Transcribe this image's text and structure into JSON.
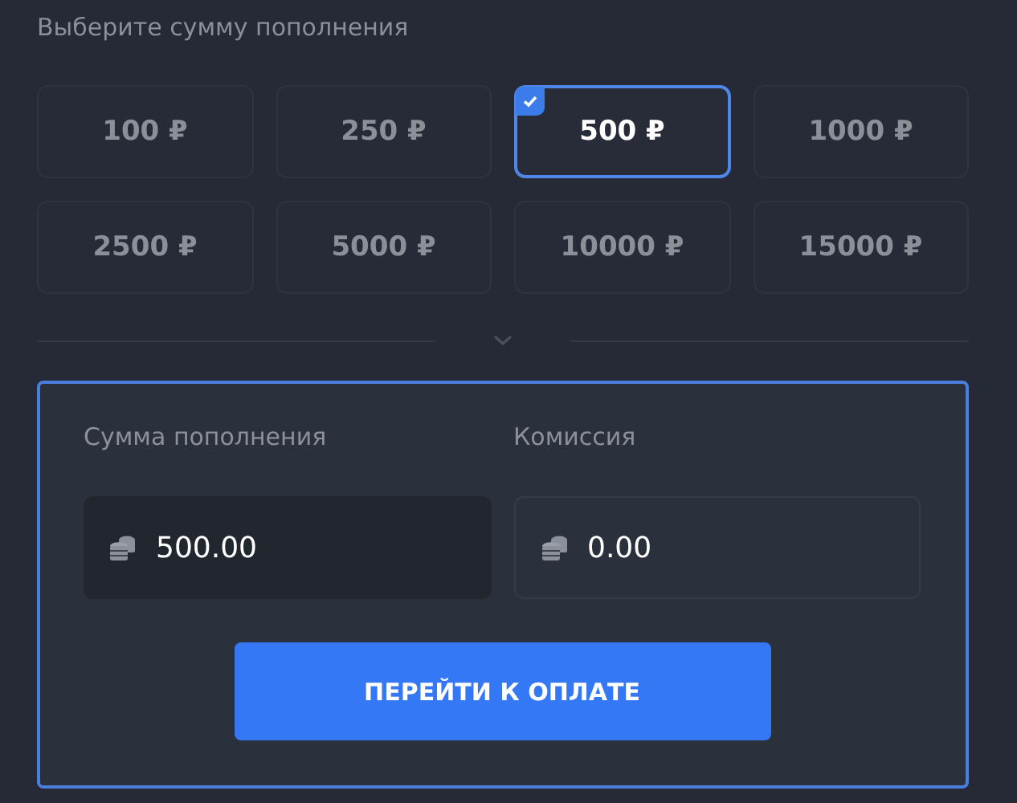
{
  "heading": "Выберите сумму пополнения",
  "amounts": [
    {
      "label": "100 ₽",
      "selected": false
    },
    {
      "label": "250 ₽",
      "selected": false
    },
    {
      "label": "500 ₽",
      "selected": true
    },
    {
      "label": "1000 ₽",
      "selected": false
    },
    {
      "label": "2500 ₽",
      "selected": false
    },
    {
      "label": "5000 ₽",
      "selected": false
    },
    {
      "label": "10000 ₽",
      "selected": false
    },
    {
      "label": "15000 ₽",
      "selected": false
    }
  ],
  "fields": [
    {
      "label": "Сумма пополнения",
      "value": "500.00",
      "kind": "input"
    },
    {
      "label": "Комиссия",
      "value": "0.00",
      "kind": "readonly"
    }
  ],
  "pay_button": "ПЕРЕЙТИ К ОПЛАТЕ"
}
